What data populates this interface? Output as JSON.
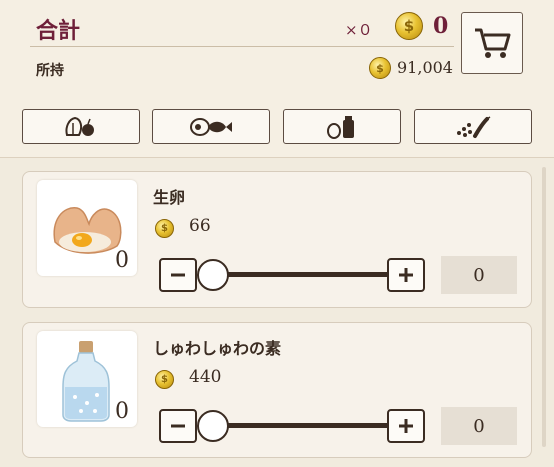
{
  "summary": {
    "total_label": "合計",
    "count_text": "×０",
    "total_value": "0",
    "owned_label": "所持",
    "owned_value": "91,004"
  },
  "icons": {
    "coin": "coin-icon",
    "cart": "cart-icon",
    "categories": [
      "vegetable-fruit-icon",
      "meat-fish-icon",
      "egg-dairy-icon",
      "spice-icon"
    ]
  },
  "items": [
    {
      "name": "生卵",
      "price": "66",
      "owned": "0",
      "quantity": "0",
      "slider_fraction": 0
    },
    {
      "name": "しゅわしゅわの素",
      "price": "440",
      "owned": "0",
      "quantity": "0",
      "slider_fraction": 0
    }
  ],
  "colors": {
    "accent": "#6e1f38",
    "coin": "#e8c232",
    "background": "#f1ebde"
  }
}
